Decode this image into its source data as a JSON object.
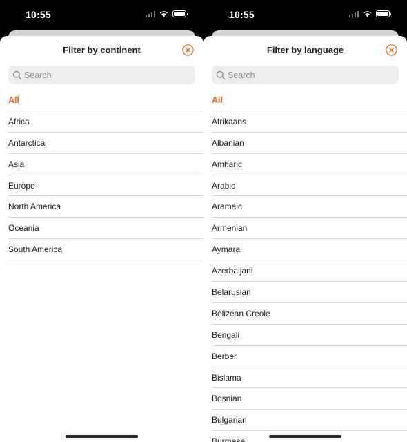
{
  "colors": {
    "accent": "#f26a21",
    "separator": "#d8d8d8",
    "search_bg": "#eeeeef"
  },
  "screens": [
    {
      "status": {
        "time": "10:55"
      },
      "sheet": {
        "title": "Filter by continent",
        "search_placeholder": "Search",
        "items": [
          "All",
          "Africa",
          "Antarctica",
          "Asia",
          "Europe",
          "North America",
          "Oceania",
          "South America"
        ],
        "selected": "All"
      }
    },
    {
      "status": {
        "time": "10:55"
      },
      "sheet": {
        "title": "Filter by language",
        "search_placeholder": "Search",
        "items": [
          "All",
          "Afrikaans",
          "Albanian",
          "Amharic",
          "Arabic",
          "Aramaic",
          "Armenian",
          "Aymara",
          "Azerbaijani",
          "Belarusian",
          "Belizean Creole",
          "Bengali",
          "Berber",
          "Bislama",
          "Bosnian",
          "Bulgarian",
          "Burmese"
        ],
        "selected": "All"
      }
    }
  ]
}
